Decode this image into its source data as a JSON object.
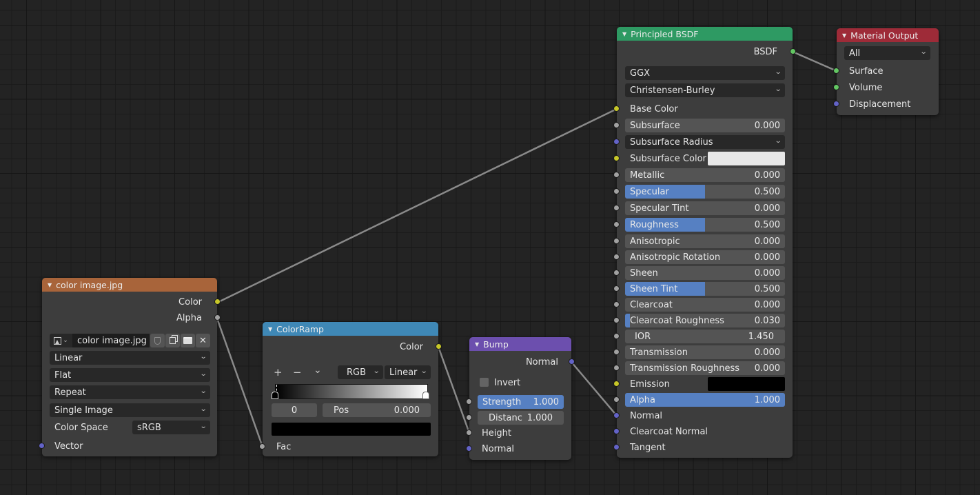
{
  "colors": {
    "socket_color": "#c7c729",
    "socket_float": "#a1a1a1",
    "socket_vector": "#6363c7",
    "socket_shader": "#63c763",
    "header_texture": "#a8643a",
    "header_converter": "#3f88b6",
    "header_vector": "#6c4fae",
    "header_shader": "#2e9a63",
    "header_output": "#9e2b38",
    "slider_fill": "#5680c2"
  },
  "image_node": {
    "title": "color image.jpg",
    "outputs": [
      "Color",
      "Alpha"
    ],
    "image_name": "color image.jpg",
    "icons": [
      "image-browse-icon",
      "fake-user-shield-icon",
      "duplicate-icon",
      "open-folder-icon",
      "close-icon"
    ],
    "interpolation": "Linear",
    "projection": "Flat",
    "extension": "Repeat",
    "source": "Single Image",
    "color_space_label": "Color Space",
    "color_space": "sRGB",
    "inputs": [
      "Vector"
    ]
  },
  "colorramp_node": {
    "title": "ColorRamp",
    "output": "Color",
    "add_label": "+",
    "remove_label": "−",
    "menu_label": "⌄",
    "color_mode": "RGB",
    "interpolation": "Linear",
    "active_index": "0",
    "pos_label": "Pos",
    "pos_value": "0.000",
    "stops": [
      {
        "pos": 0.0,
        "color": "#000000"
      },
      {
        "pos": 1.0,
        "color": "#ffffff"
      }
    ],
    "active_color": "#000000",
    "input": "Fac"
  },
  "bump_node": {
    "title": "Bump",
    "output": "Normal",
    "invert_label": "Invert",
    "invert_checked": false,
    "strength_label": "Strength",
    "strength_value": "1.000",
    "strength_fraction": 1.0,
    "distance_label": "Distanc",
    "distance_value": "1.000",
    "inputs": [
      "Height",
      "Normal"
    ]
  },
  "bsdf_node": {
    "title": "Principled BSDF",
    "output": "BSDF",
    "distribution": "GGX",
    "subsurface_method": "Christensen-Burley",
    "base_color_label": "Base Color",
    "subsurface_radius_label": "Subsurface Radius",
    "subsurface_color_label": "Subsurface Color",
    "subsurface_color": "#e8e8e8",
    "emission_label": "Emission",
    "emission_color": "#000000",
    "sliders": [
      {
        "label": "Subsurface",
        "value": "0.000",
        "fraction": 0.0
      },
      {
        "label": "Metallic",
        "value": "0.000",
        "fraction": 0.0
      },
      {
        "label": "Specular",
        "value": "0.500",
        "fraction": 0.5
      },
      {
        "label": "Specular Tint",
        "value": "0.000",
        "fraction": 0.0
      },
      {
        "label": "Roughness",
        "value": "0.500",
        "fraction": 0.5
      },
      {
        "label": "Anisotropic",
        "value": "0.000",
        "fraction": 0.0
      },
      {
        "label": "Anisotropic Rotation",
        "value": "0.000",
        "fraction": 0.0
      },
      {
        "label": "Sheen",
        "value": "0.000",
        "fraction": 0.0
      },
      {
        "label": "Sheen Tint",
        "value": "0.500",
        "fraction": 0.5
      },
      {
        "label": "Clearcoat",
        "value": "0.000",
        "fraction": 0.0
      },
      {
        "label": "Clearcoat Roughness",
        "value": "0.030",
        "fraction": 0.03
      },
      {
        "label": "IOR",
        "value": "1.450",
        "fraction": 0.0
      },
      {
        "label": "Transmission",
        "value": "0.000",
        "fraction": 0.0
      },
      {
        "label": "Transmission Roughness",
        "value": "0.000",
        "fraction": 0.0
      },
      {
        "label": "Alpha",
        "value": "1.000",
        "fraction": 1.0
      }
    ],
    "vector_inputs": [
      "Normal",
      "Clearcoat Normal",
      "Tangent"
    ]
  },
  "output_node": {
    "title": "Material Output",
    "target": "All",
    "inputs": [
      "Surface",
      "Volume",
      "Displacement"
    ]
  }
}
